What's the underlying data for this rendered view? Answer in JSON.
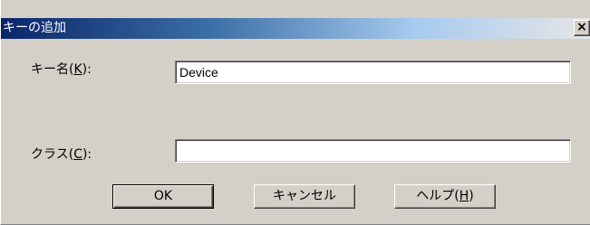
{
  "dialog": {
    "title": "キーの追加",
    "close_glyph": "×"
  },
  "fields": {
    "key_name_label": "キー名(K):",
    "key_name_label_prefix": "キー名(",
    "key_name_label_mnemonic": "K",
    "key_name_label_suffix": "):",
    "key_name_value": "Device",
    "class_label_prefix": "クラス(",
    "class_label_mnemonic": "C",
    "class_label_suffix": "):",
    "class_value": ""
  },
  "buttons": {
    "ok": "OK",
    "cancel": "キャンセル",
    "help_prefix": "ヘルプ(",
    "help_mnemonic": "H",
    "help_suffix": ")"
  },
  "colors": {
    "dialog_face": "#d4d0c8",
    "title_start": "#0a246a",
    "title_end": "#a6caf0"
  }
}
